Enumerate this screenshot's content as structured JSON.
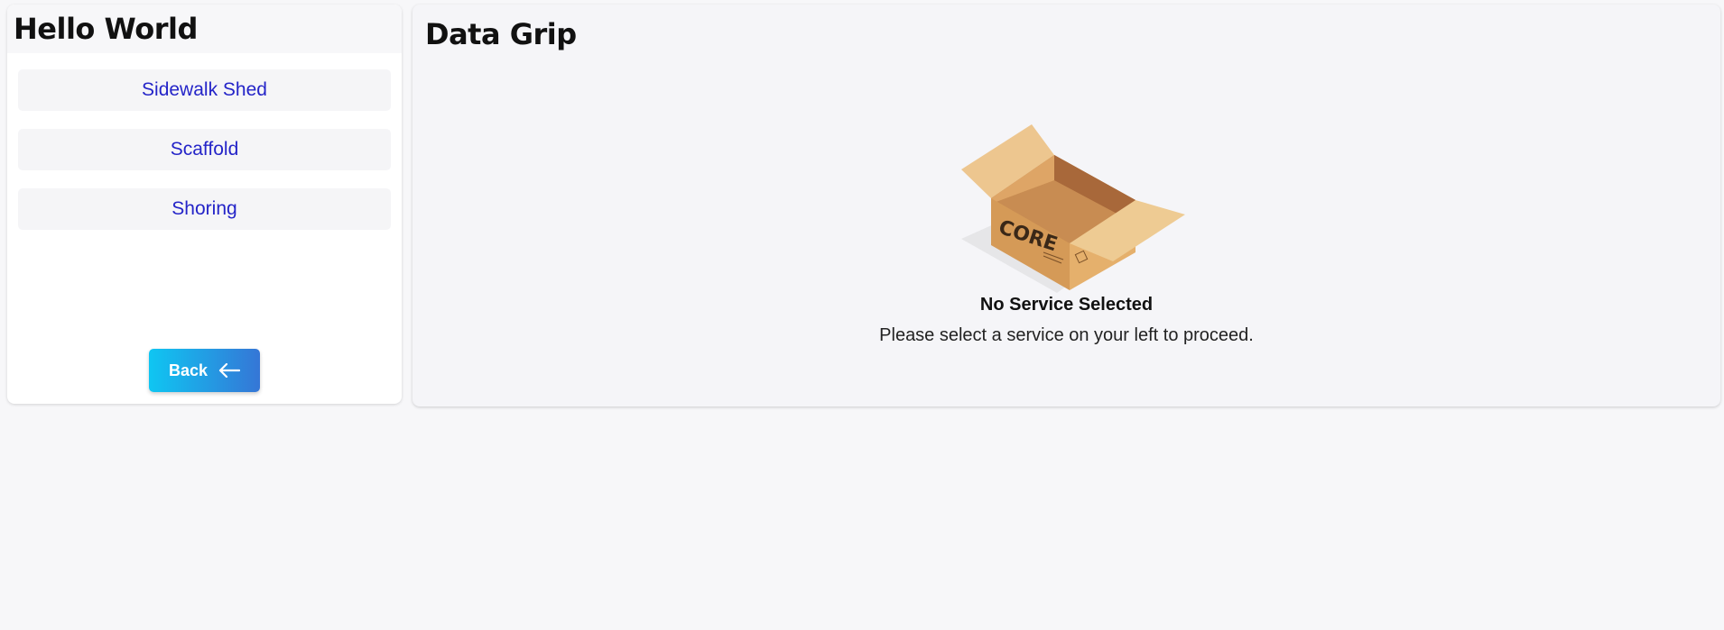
{
  "sidebar": {
    "title": "Hello World",
    "services": [
      {
        "label": "Sidewalk Shed"
      },
      {
        "label": "Scaffold"
      },
      {
        "label": "Shoring"
      }
    ],
    "back_button": {
      "label": "Back",
      "icon": "arrow-left-icon"
    }
  },
  "main": {
    "title": "Data Grip",
    "empty_state": {
      "icon": "empty-box-icon",
      "box_logo": "CORE",
      "title": "No Service Selected",
      "message": "Please select a service on your left to proceed."
    }
  },
  "colors": {
    "link": "#2424c8",
    "button_gradient_start": "#0fc6f2",
    "button_gradient_end": "#3576d6",
    "background": "#f7f7f9"
  }
}
